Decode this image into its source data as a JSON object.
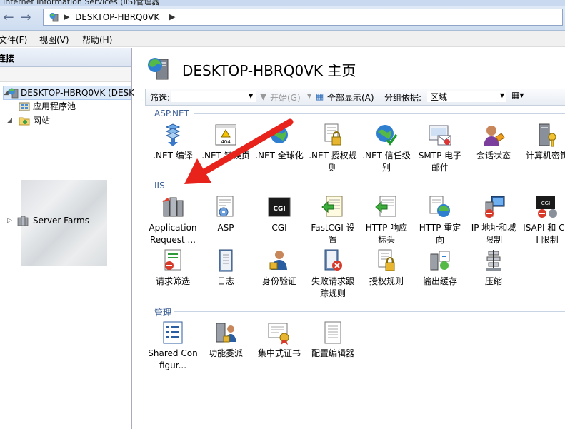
{
  "window": {
    "title": "Internet Information Services (IIS)管理器"
  },
  "address": {
    "segments": [
      "DESKTOP-HBRQ0VK"
    ]
  },
  "menu": {
    "file": "文件(F)",
    "view": "视图(V)",
    "help": "帮助(H)"
  },
  "connections": {
    "header": "连接",
    "tree": {
      "server": "DESKTOP-HBRQ0VK (DESK",
      "app_pools": "应用程序池",
      "sites": "网站",
      "server_farms": "Server Farms"
    }
  },
  "main": {
    "title": "DESKTOP-HBRQ0VK 主页",
    "filter": {
      "label": "筛选:",
      "go": "开始(G)",
      "show_all": "全部显示(A)",
      "group_by_label": "分组依据:",
      "group_by_value": "区域"
    },
    "groups": {
      "aspnet": {
        "label": "ASP.NET",
        "features": [
          {
            "label": ".NET 编译",
            "icon": "net-compile-icon"
          },
          {
            "label": ".NET 错误页",
            "icon": "net-error-pages-icon"
          },
          {
            "label": ".NET 全球化",
            "icon": "net-globalization-icon"
          },
          {
            "label": ".NET 授权规则",
            "icon": "net-authorization-icon"
          },
          {
            "label": ".NET 信任级别",
            "icon": "net-trust-icon"
          },
          {
            "label": "SMTP 电子邮件",
            "icon": "smtp-email-icon"
          },
          {
            "label": "会话状态",
            "icon": "session-state-icon"
          },
          {
            "label": "计算机密钥",
            "icon": "machine-key-icon"
          }
        ]
      },
      "iis": {
        "label": "IIS",
        "features": [
          {
            "label": "Application Request ...",
            "icon": "arr-icon"
          },
          {
            "label": "ASP",
            "icon": "asp-icon"
          },
          {
            "label": "CGI",
            "icon": "cgi-icon"
          },
          {
            "label": "FastCGI 设置",
            "icon": "fastcgi-icon"
          },
          {
            "label": "HTTP 响应标头",
            "icon": "http-headers-icon"
          },
          {
            "label": "HTTP 重定向",
            "icon": "http-redirect-icon"
          },
          {
            "label": "IP 地址和域限制",
            "icon": "ip-restrictions-icon"
          },
          {
            "label": "ISAPI 和 CGI 限制",
            "icon": "isapi-cgi-icon"
          },
          {
            "label": "请求筛选",
            "icon": "request-filtering-icon"
          },
          {
            "label": "日志",
            "icon": "logging-icon"
          },
          {
            "label": "身份验证",
            "icon": "authentication-icon"
          },
          {
            "label": "失败请求跟踪规则",
            "icon": "failed-request-icon"
          },
          {
            "label": "授权规则",
            "icon": "authorization-icon"
          },
          {
            "label": "输出缓存",
            "icon": "output-cache-icon"
          },
          {
            "label": "压缩",
            "icon": "compression-icon"
          }
        ]
      },
      "manage": {
        "label": "管理",
        "features": [
          {
            "label": "Shared Configur...",
            "icon": "shared-config-icon"
          },
          {
            "label": "功能委派",
            "icon": "feature-delegation-icon"
          },
          {
            "label": "集中式证书",
            "icon": "central-certs-icon"
          },
          {
            "label": "配置编辑器",
            "icon": "config-editor-icon"
          }
        ]
      }
    }
  },
  "annotation": {
    "color": "#e8231b"
  }
}
